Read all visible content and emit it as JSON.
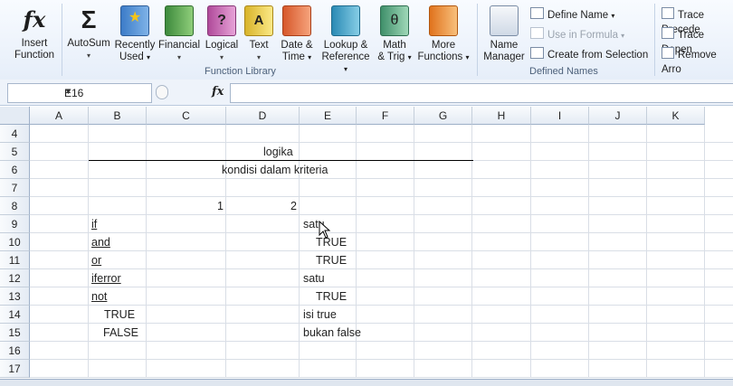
{
  "ribbon": {
    "buttons": [
      {
        "label": "Insert\nFunction",
        "icon": "fx-icon"
      },
      {
        "label": "AutoSum",
        "icon": "sigma-icon"
      },
      {
        "label": "Recently\nUsed",
        "icon": "star-book-icon"
      },
      {
        "label": "Financial",
        "icon": "financial-book-icon"
      },
      {
        "label": "Logical",
        "icon": "question-book-icon"
      },
      {
        "label": "Text",
        "icon": "text-book-icon"
      },
      {
        "label": "Date &\nTime",
        "icon": "calendar-book-icon"
      },
      {
        "label": "Lookup &\nReference",
        "icon": "lookup-book-icon"
      },
      {
        "label": "Math\n& Trig",
        "icon": "theta-book-icon"
      },
      {
        "label": "More\nFunctions",
        "icon": "stack-books-icon"
      },
      {
        "label": "Name\nManager",
        "icon": "name-manager-icon"
      }
    ],
    "insert_function": "Insert",
    "insert_function2": "Function",
    "autosum": "AutoSum",
    "recently": "Recently",
    "recently2": "Used",
    "financial": "Financial",
    "logical": "Logical",
    "text": "Text",
    "datetime": "Date &",
    "datetime2": "Time",
    "lookup": "Lookup &",
    "lookup2": "Reference",
    "math": "Math",
    "math2": "& Trig",
    "more": "More",
    "more2": "Functions",
    "name_manager": "Name",
    "name_manager2": "Manager",
    "define_name": "Define Name",
    "use_in_formula": "Use in Formula",
    "create_from_selection": "Create from Selection",
    "trace_precedents": "Trace Precede",
    "trace_dependents": "Trace Depen",
    "remove_arrows": "Remove Arro",
    "group_function_library": "Function Library",
    "group_defined_names": "Defined Names",
    "caret": "▾"
  },
  "formula_bar": {
    "name_box": "E16",
    "fx": "fx",
    "formula": ""
  },
  "columns": [
    "A",
    "B",
    "C",
    "D",
    "E",
    "F",
    "G",
    "H",
    "I",
    "J",
    "K"
  ],
  "rows": [
    "4",
    "5",
    "6",
    "7",
    "8",
    "9",
    "10",
    "11",
    "12",
    "13",
    "14",
    "15",
    "16",
    "17"
  ],
  "cells": {
    "c5": "logika",
    "c6": "kondisi dalam kriteria",
    "c8": "1",
    "d8": "2",
    "b9": "if",
    "e9": "satu",
    "b10": "and",
    "e10": "TRUE",
    "b11": "or",
    "e11": "TRUE",
    "b12": "iferror",
    "e12": "satu",
    "b13": "not",
    "e13": "TRUE",
    "b14": "TRUE",
    "e14": "isi true",
    "b15": "FALSE",
    "e15": "bukan false"
  }
}
